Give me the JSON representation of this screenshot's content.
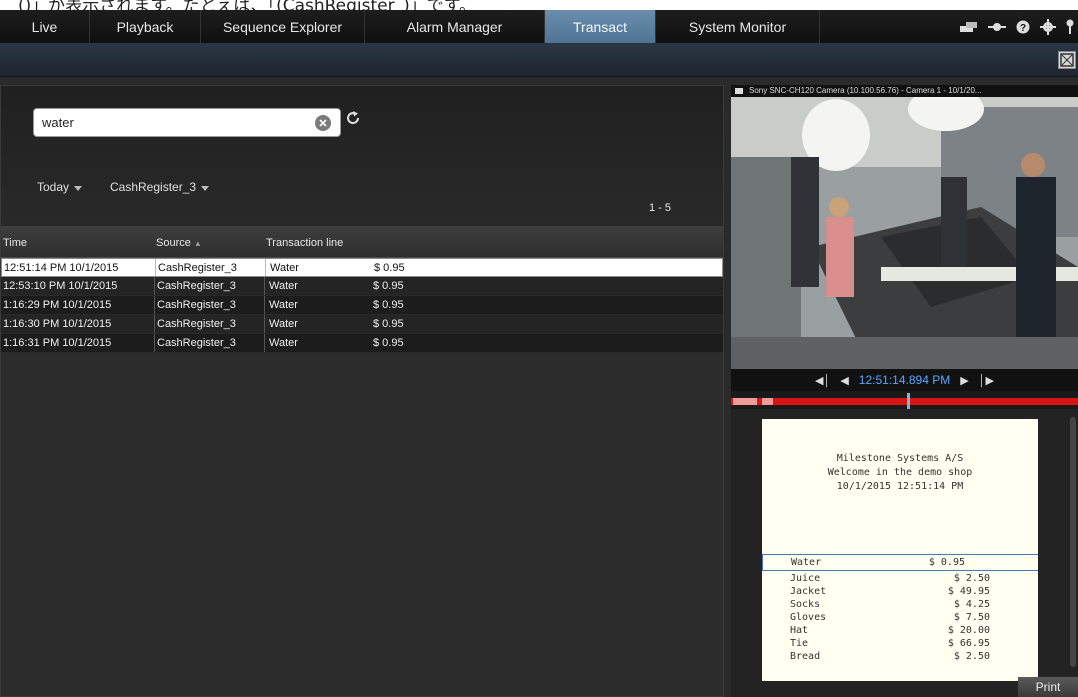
{
  "caption": "()」が表示されます。たとえば、「(CashRegister_)」です。",
  "tabs": [
    {
      "label": "Live"
    },
    {
      "label": "Playback"
    },
    {
      "label": "Sequence Explorer"
    },
    {
      "label": "Alarm Manager"
    },
    {
      "label": "Transact",
      "active": true
    },
    {
      "label": "System Monitor"
    }
  ],
  "toolbar_icons": [
    "tile-icon",
    "monitor-icon",
    "help-icon",
    "settings-icon",
    "key-icon"
  ],
  "search": {
    "value": "water"
  },
  "filters": {
    "date": "Today",
    "source": "CashRegister_3"
  },
  "range": "1 - 5",
  "table": {
    "headers": {
      "time": "Time",
      "source": "Source",
      "line": "Transaction line"
    },
    "rows": [
      {
        "time": "12:51:14 PM 10/1/2015",
        "source": "CashRegister_3",
        "item": "Water",
        "price": "$ 0.95",
        "selected": true
      },
      {
        "time": "12:53:10 PM 10/1/2015",
        "source": "CashRegister_3",
        "item": "Water",
        "price": "$ 0.95"
      },
      {
        "time": "1:16:29 PM 10/1/2015",
        "source": "CashRegister_3",
        "item": "Water",
        "price": "$ 0.95"
      },
      {
        "time": "1:16:30 PM 10/1/2015",
        "source": "CashRegister_3",
        "item": "Water",
        "price": "$ 0.95"
      },
      {
        "time": "1:16:31 PM 10/1/2015",
        "source": "CashRegister_3",
        "item": "Water",
        "price": "$ 0.95"
      }
    ]
  },
  "camera": {
    "title": "Sony SNC-CH120 Camera (10.100.56.76) - Camera 1 - 10/1/20...",
    "timestamp": "12:51:14.894 PM"
  },
  "receipt": {
    "header": [
      "Milestone Systems A/S",
      "Welcome in the demo shop",
      "10/1/2015 12:51:14 PM"
    ],
    "items": [
      {
        "name": "Water",
        "price": "$ 0.95",
        "highlight": true
      },
      {
        "name": "Juice",
        "price": "$ 2.50"
      },
      {
        "name": "Jacket",
        "price": "$ 49.95"
      },
      {
        "name": "Socks",
        "price": "$ 4.25"
      },
      {
        "name": "Gloves",
        "price": "$ 7.50"
      },
      {
        "name": "Hat",
        "price": "$ 20.00"
      },
      {
        "name": "Tie",
        "price": "$ 66.95"
      },
      {
        "name": "Bread",
        "price": "$ 2.50"
      }
    ]
  },
  "print_label": "Print"
}
